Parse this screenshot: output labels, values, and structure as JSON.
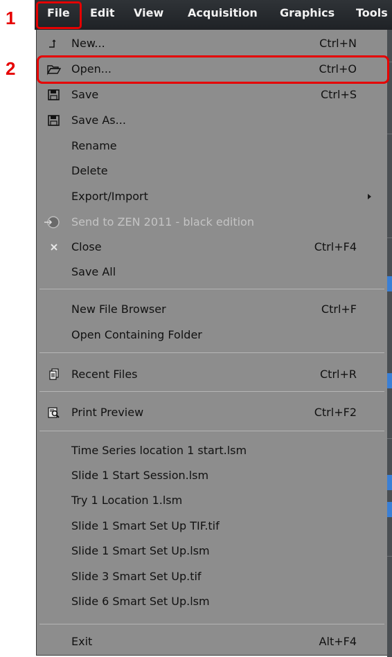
{
  "callouts": {
    "one": "1",
    "two": "2"
  },
  "menubar": {
    "items": [
      "File",
      "Edit",
      "View",
      "Acquisition",
      "Graphics",
      "Tools"
    ]
  },
  "menu": {
    "new": {
      "label": "New...",
      "shortcut": "Ctrl+N"
    },
    "open": {
      "label": "Open...",
      "shortcut": "Ctrl+O"
    },
    "save": {
      "label": "Save",
      "shortcut": "Ctrl+S"
    },
    "save_as": {
      "label": "Save As..."
    },
    "rename": {
      "label": "Rename"
    },
    "delete": {
      "label": "Delete"
    },
    "export_import": {
      "label": "Export/Import"
    },
    "send_to_zen": {
      "label": "Send to ZEN 2011 - black edition"
    },
    "close": {
      "label": "Close",
      "shortcut": "Ctrl+F4"
    },
    "save_all": {
      "label": "Save All"
    },
    "new_file_browser": {
      "label": "New File Browser",
      "shortcut": "Ctrl+F"
    },
    "open_containing_folder": {
      "label": "Open Containing Folder"
    },
    "recent_files": {
      "label": "Recent Files",
      "shortcut": "Ctrl+R"
    },
    "print_preview": {
      "label": "Print Preview",
      "shortcut": "Ctrl+F2"
    },
    "recent_list": [
      "Time Series location 1 start.lsm",
      "Slide 1 Start Session.lsm",
      "Try 1 Location 1.lsm",
      "Slide 1 Smart Set Up TIF.tif",
      "Slide 1 Smart Set Up.lsm",
      "Slide 3 Smart Set Up.tif",
      "Slide 6 Smart Set Up.lsm"
    ],
    "exit": {
      "label": "Exit",
      "shortcut": "Alt+F4"
    }
  },
  "colors": {
    "annotation": "#e60000",
    "menu_bg": "#8d8d8d",
    "menubar_bg": "#25282c",
    "disabled_text": "#c4c4c4",
    "accent": "#3a7fd5"
  }
}
